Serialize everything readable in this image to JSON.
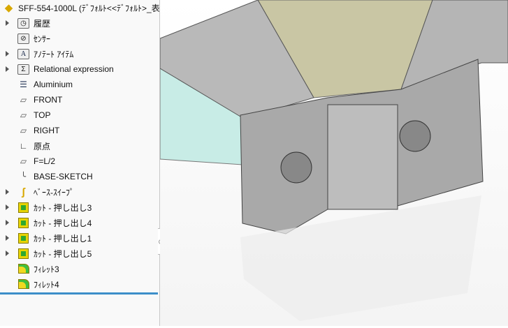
{
  "tree": {
    "root": "SFF-554-1000L  (ﾃﾞﾌｫﾙﾄ<<ﾃﾞﾌｫﾙﾄ>_表:",
    "items": [
      {
        "label": "履歴",
        "icon": "history-folder-icon",
        "expand": true
      },
      {
        "label": "ｾﾝｻｰ",
        "icon": "sensor-folder-icon",
        "expand": false
      },
      {
        "label": "ｱﾉﾃｰﾄ ｱｲﾃﾑ",
        "icon": "annotation-folder-icon",
        "expand": true
      },
      {
        "label": "Relational expression",
        "icon": "equation-folder-icon",
        "expand": true
      },
      {
        "label": "Aluminium",
        "icon": "material-icon",
        "expand": false
      },
      {
        "label": "FRONT",
        "icon": "plane-icon",
        "expand": false
      },
      {
        "label": "TOP",
        "icon": "plane-icon",
        "expand": false
      },
      {
        "label": "RIGHT",
        "icon": "plane-icon",
        "expand": false
      },
      {
        "label": "原点",
        "icon": "origin-icon",
        "expand": false
      },
      {
        "label": "F=L/2",
        "icon": "plane-icon",
        "expand": false
      },
      {
        "label": "BASE-SKETCH",
        "icon": "sketch-icon",
        "expand": false
      },
      {
        "label": "ﾍﾞｰｽ-ｽｲｰﾌﾟ",
        "icon": "sweep-icon",
        "expand": true
      },
      {
        "label": "ｶｯﾄ - 押し出し3",
        "icon": "cut-extrude-icon",
        "expand": true
      },
      {
        "label": "ｶｯﾄ - 押し出し4",
        "icon": "cut-extrude-icon",
        "expand": true
      },
      {
        "label": "ｶｯﾄ - 押し出し1",
        "icon": "cut-extrude-icon",
        "expand": true
      },
      {
        "label": "ｶｯﾄ - 押し出し5",
        "icon": "cut-extrude-icon",
        "expand": true
      },
      {
        "label": "ﾌｨﾚｯﾄ3",
        "icon": "fillet-icon",
        "expand": false
      },
      {
        "label": "ﾌｨﾚｯﾄ4",
        "icon": "fillet-icon",
        "expand": false
      }
    ]
  },
  "colors": {
    "accent": "#3d8fc9",
    "top_face": "#c9c6a4",
    "side_face": "#c8ece6",
    "metal": "#a8a8a8"
  }
}
